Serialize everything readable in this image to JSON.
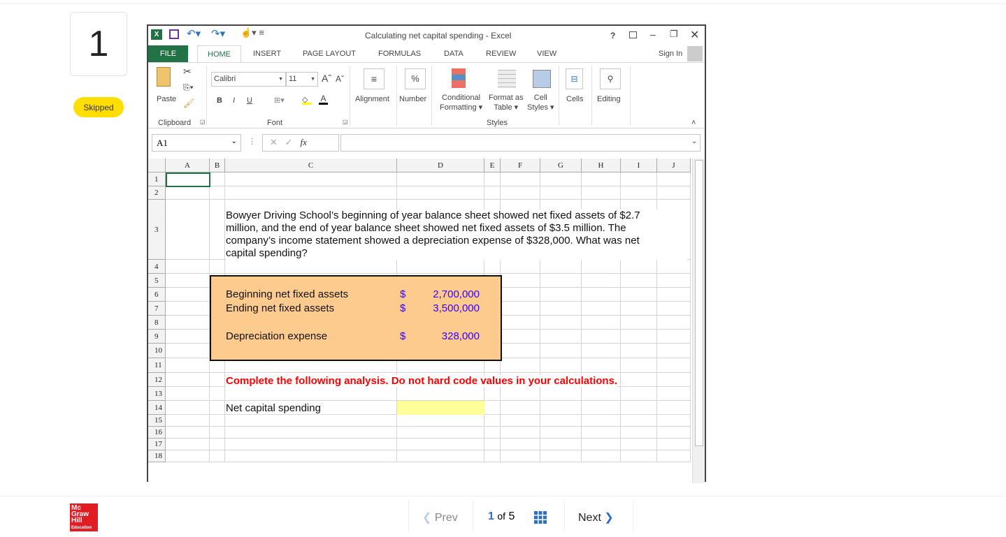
{
  "question": {
    "number": "1",
    "status": "Skipped"
  },
  "excel": {
    "title": "Calculating net capital spending - Excel",
    "title_icons": [
      "help-icon",
      "ribbon-display-icon",
      "minimize-icon",
      "restore-icon",
      "close-icon"
    ],
    "help": "?",
    "tabs": [
      "FILE",
      "HOME",
      "INSERT",
      "PAGE LAYOUT",
      "FORMULAS",
      "DATA",
      "REVIEW",
      "VIEW"
    ],
    "sign_in": "Sign In",
    "ribbon": {
      "paste": "Paste",
      "clipboard": "Clipboard",
      "font_name": "Calibri",
      "font_size": "11",
      "bold": "B",
      "italic": "I",
      "underline": "U",
      "font": "Font",
      "alignment": "Alignment",
      "number": "Number",
      "percent": "%",
      "conditional": [
        "Conditional",
        "Formatting"
      ],
      "format_table": [
        "Format as",
        "Table"
      ],
      "cell_styles": [
        "Cell",
        "Styles"
      ],
      "styles": "Styles",
      "cells": "Cells",
      "editing": "Editing"
    },
    "name_box": "A1",
    "fx": "fx",
    "formula": "",
    "columns": [
      "A",
      "B",
      "C",
      "D",
      "E",
      "F",
      "G",
      "H",
      "I",
      "J"
    ],
    "rows": [
      "1",
      "2",
      "3",
      "4",
      "5",
      "6",
      "7",
      "8",
      "9",
      "10",
      "11",
      "12",
      "13",
      "14",
      "15",
      "16",
      "17",
      "18"
    ],
    "problem": [
      "Bowyer Driving School’s beginning of year balance sheet showed net fixed assets of $2.7",
      "million, and the end of year balance sheet showed net fixed assets of $3.5 million. The",
      "company’s income statement showed a depreciation expense of $328,000. What was net",
      "capital spending?"
    ],
    "inputs": [
      {
        "label": "Beginning net fixed assets",
        "currency": "$",
        "value": "2,700,000"
      },
      {
        "label": "Ending net fixed assets",
        "currency": "$",
        "value": "3,500,000"
      },
      {
        "label": "Depreciation expense",
        "currency": "$",
        "value": "328,000"
      }
    ],
    "instruction": "Complete the following analysis. Do not hard code values in your calculations.",
    "answer_label": "Net capital spending",
    "answer_value": "",
    "colors": {
      "input_box": "#fecb8f",
      "answer_cell": "#ffff99",
      "instruction": "#ff0000",
      "value": "#3300ff",
      "excel_green": "#217346"
    }
  },
  "footer": {
    "logo": [
      "Mc",
      "Graw",
      "Hill",
      "Education"
    ],
    "prev": "Prev",
    "page_current": "1",
    "page_of": "of",
    "page_total": "5",
    "next": "Next"
  }
}
